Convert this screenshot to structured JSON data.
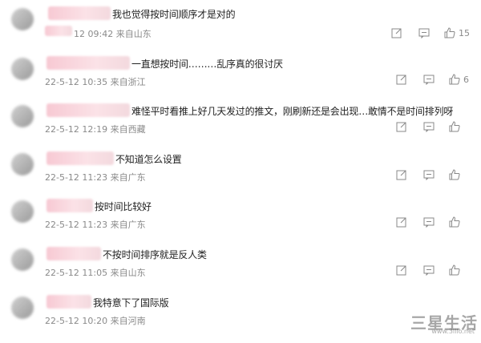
{
  "comments": [
    {
      "text": "我也觉得按时间顺序才是对的",
      "date": "12 09:42",
      "location": "来自山东",
      "likes": "15"
    },
    {
      "text": "一直想按时间………乱序真的很讨厌",
      "date": "22-5-12 10:35",
      "location": "来自浙江",
      "likes": "6"
    },
    {
      "text": "难怪平时看推上好几天发过的推文，刚刷新还是会出现…敢情不是时间排列呀",
      "date": "22-5-12 12:19",
      "location": "来自西藏",
      "likes": ""
    },
    {
      "text": "不知道怎么设置",
      "date": "22-5-12 11:23",
      "location": "来自广东",
      "likes": ""
    },
    {
      "text": "按时间比较好",
      "date": "22-5-12 11:23",
      "location": "来自广东",
      "likes": ""
    },
    {
      "text": "不按时间排序就是反人类",
      "date": "22-5-12 11:05",
      "location": "来自山东",
      "likes": ""
    },
    {
      "text": "我特意下了国际版",
      "date": "22-5-12 10:20",
      "location": "来自河南",
      "likes": ""
    }
  ],
  "icons": {
    "share": "share-icon",
    "comment": "comment-icon",
    "like": "like-icon"
  },
  "watermark": {
    "text": "三星生活",
    "sub": "www.3lllo.net"
  }
}
